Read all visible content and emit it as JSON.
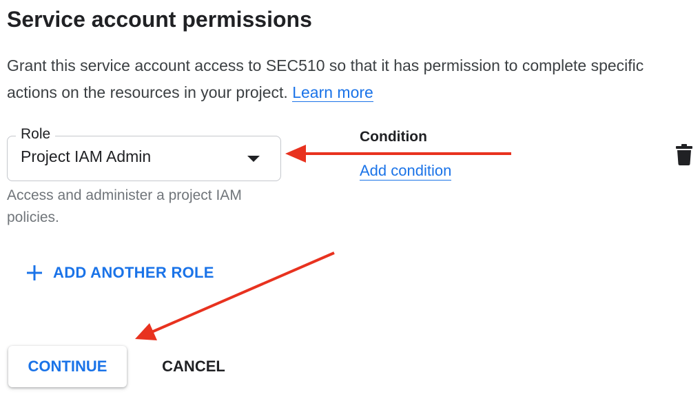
{
  "header": {
    "title": "Service account permissions"
  },
  "description": {
    "text": "Grant this service account access to SEC510 so that it has permission to complete specific actions on the resources in your project. ",
    "learn_more": "Learn more"
  },
  "role": {
    "label": "Role",
    "value": "Project IAM Admin",
    "helper": "Access and administer a project IAM policies."
  },
  "condition": {
    "label": "Condition",
    "add_label": "Add condition"
  },
  "actions": {
    "add_role": "ADD ANOTHER ROLE",
    "continue": "CONTINUE",
    "cancel": "CANCEL"
  },
  "icons": {
    "dropdown": "caret-down-icon",
    "delete": "trash-icon",
    "add": "plus-icon"
  },
  "colors": {
    "accent": "#1a73e8",
    "annotation_arrow": "#e8321f",
    "text_primary": "#202124",
    "text_secondary": "#70757a"
  }
}
